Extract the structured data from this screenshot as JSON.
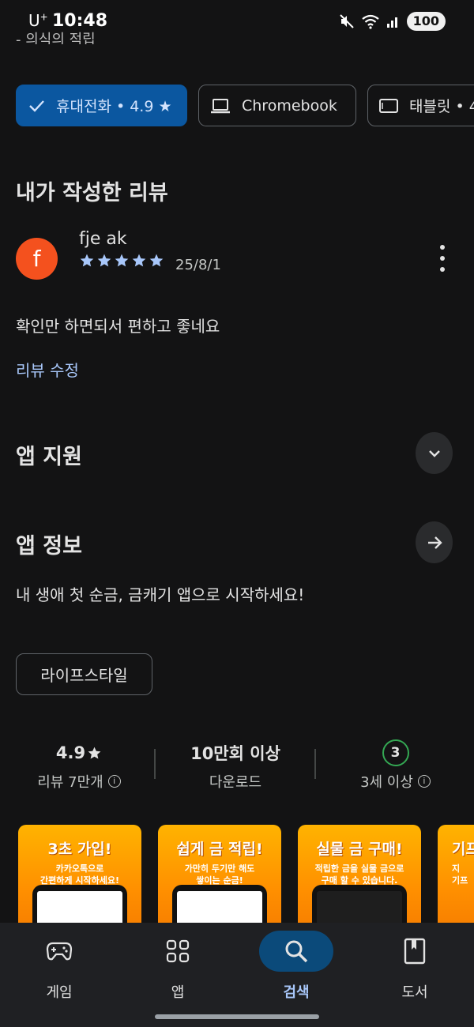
{
  "status_bar": {
    "carrier": "U",
    "carrier_sup": "+",
    "time": "10:48",
    "battery": "100"
  },
  "cut_text": "- 의식의 적립",
  "device_chips": [
    {
      "label": "휴대전화 • 4.9 ★",
      "selected": true
    },
    {
      "label": "Chromebook",
      "selected": false
    },
    {
      "label": "태블릿 • 4",
      "selected": false
    }
  ],
  "my_review": {
    "title": "내가 작성한 리뷰",
    "avatar_letter": "f",
    "reviewer": "fje ak",
    "stars": 5,
    "date": "25/8/1",
    "text": "확인만 하면되서 편하고 좋네요",
    "edit_label": "리뷰 수정"
  },
  "app_support": {
    "title": "앱 지원"
  },
  "app_info": {
    "title": "앱 정보",
    "description": "내 생애 첫 순금, 금캐기 앱으로 시작하세요!",
    "category_tag": "라이프스타일"
  },
  "stats": {
    "rating": "4.9",
    "rating_label": "리뷰 7만개",
    "downloads": "10만회 이상",
    "downloads_label": "다운로드",
    "age_badge": "3",
    "age_label": "3세 이상"
  },
  "screenshots": [
    {
      "title": "3초 가입!",
      "subtitle": "카카오톡으로\n간편하게 시작하세요!"
    },
    {
      "title": "쉽게 금 적립!",
      "subtitle": "가만히 두기만 해도\n쌓이는 순금!"
    },
    {
      "title": "실물 금 구매!",
      "subtitle": "적립한 금을 실물 금으로\n구매 할 수 있습니다."
    },
    {
      "title": "기프",
      "subtitle": "지\n기프"
    }
  ],
  "bottom_nav": [
    {
      "label": "게임",
      "icon": "gamepad-icon",
      "active": false
    },
    {
      "label": "앱",
      "icon": "apps-grid-icon",
      "active": false
    },
    {
      "label": "검색",
      "icon": "search-icon",
      "active": true
    },
    {
      "label": "도서",
      "icon": "book-icon",
      "active": false
    }
  ],
  "colors": {
    "background": "#131314",
    "accent": "#a8c7fa",
    "selected_chip": "#0b57a0",
    "star": "#a8c7fa",
    "avatar": "#f4511e",
    "screenshot_orange": "#ff8f00"
  }
}
